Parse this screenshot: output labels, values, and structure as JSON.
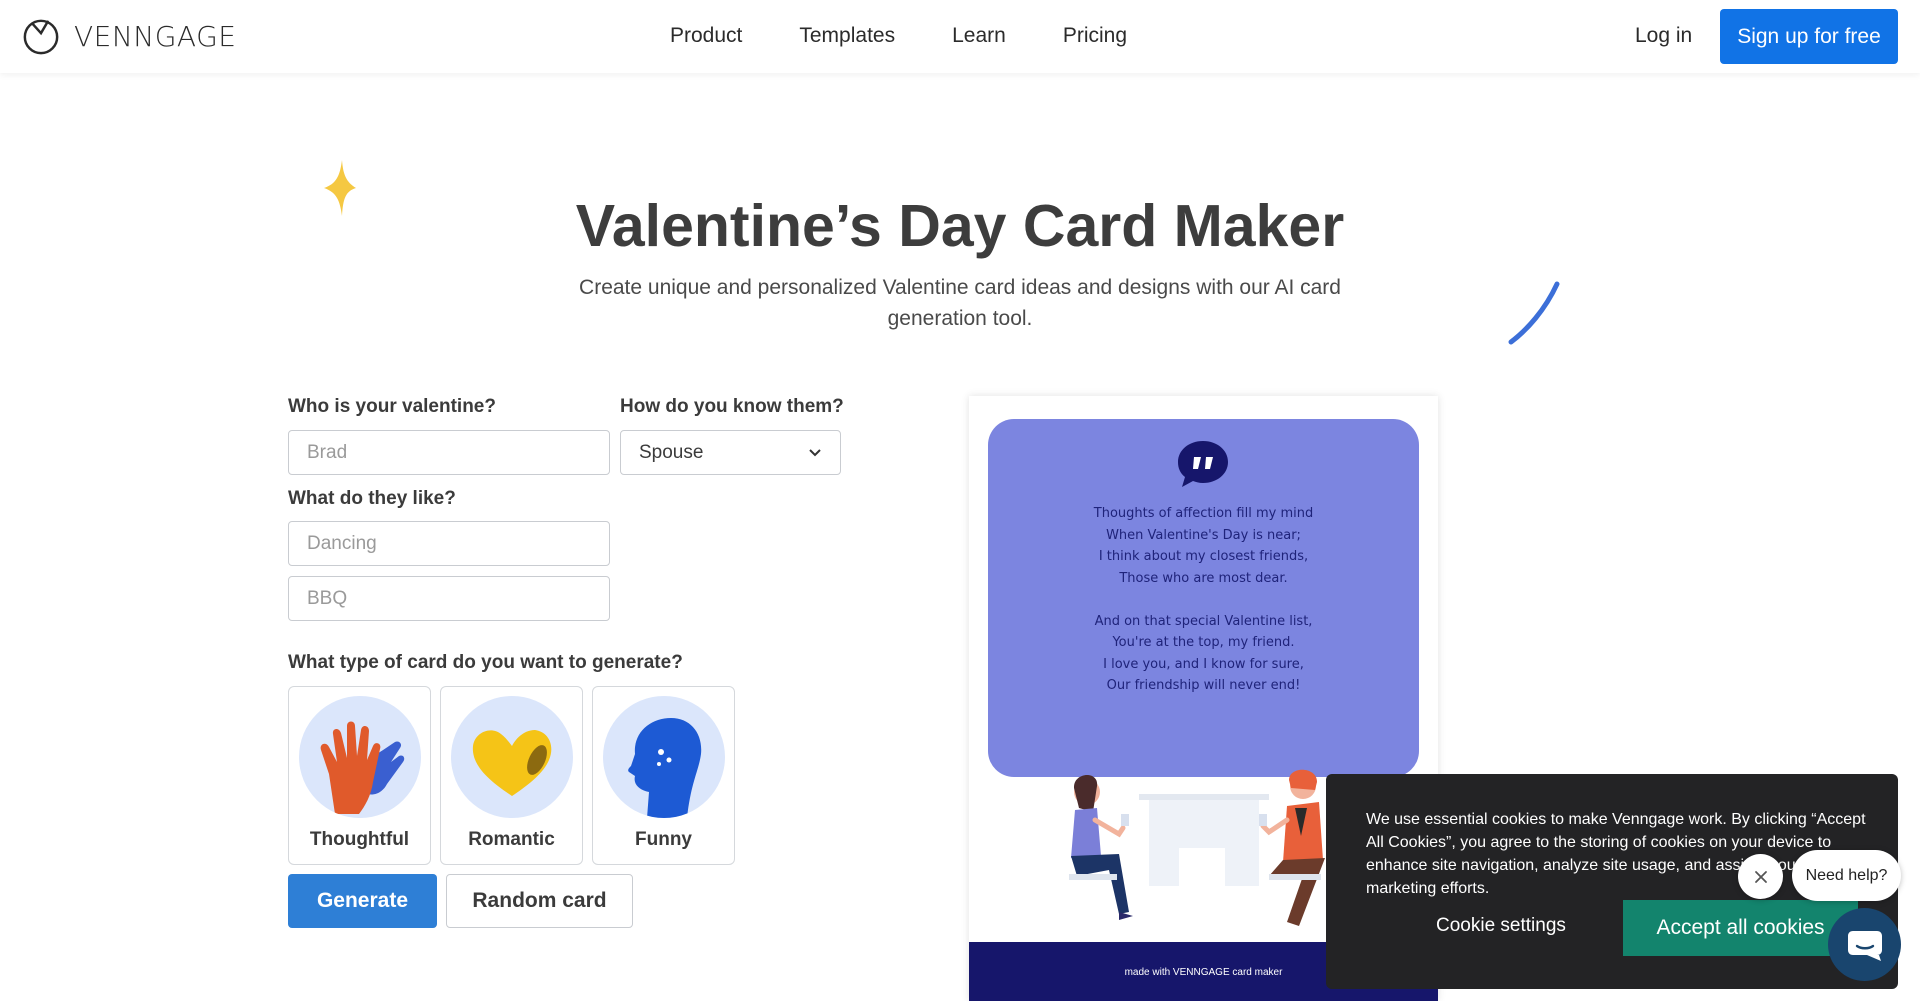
{
  "brand": {
    "name": "VENNGAGE",
    "accent": "#1173e6"
  },
  "nav": {
    "items": [
      "Product",
      "Templates",
      "Learn",
      "Pricing"
    ],
    "login": "Log in",
    "signup": "Sign up for free"
  },
  "hero": {
    "title": "Valentine’s Day Card Maker",
    "subtitle": "Create unique and personalized Valentine card ideas and designs with our AI card generation tool."
  },
  "form": {
    "valentine_label": "Who is your valentine?",
    "valentine_placeholder": "Brad",
    "relation_label": "How do you know them?",
    "relation_value": "Spouse",
    "likes_label": "What do they like?",
    "like1_placeholder": "Dancing",
    "like2_placeholder": "BBQ",
    "type_label": "What type of card do you want to generate?",
    "types": [
      "Thoughtful",
      "Romantic",
      "Funny"
    ],
    "generate": "Generate",
    "random": "Random card"
  },
  "card": {
    "poem": "Thoughts of affection fill my mind\nWhen Valentine's Day is near;\nI think about my closest friends,\nThose who are most dear.\n\nAnd on that special Valentine list,\nYou're at the top, my friend.\nI love you, and I know for sure,\nOur friendship will never end!",
    "footer": "made with VENNGAGE card maker",
    "bubble_color": "#7c85e0",
    "footer_color": "#16166b"
  },
  "cookie": {
    "text": "We use essential cookies to make Venngage work. By clicking “Accept All Cookies”, you agree to the storing of cookies on your device to enhance site navigation, analyze site usage, and assist in our marketing efforts.",
    "settings": "Cookie settings",
    "accept": "Accept all cookies"
  },
  "help": {
    "text": "Need help?"
  }
}
